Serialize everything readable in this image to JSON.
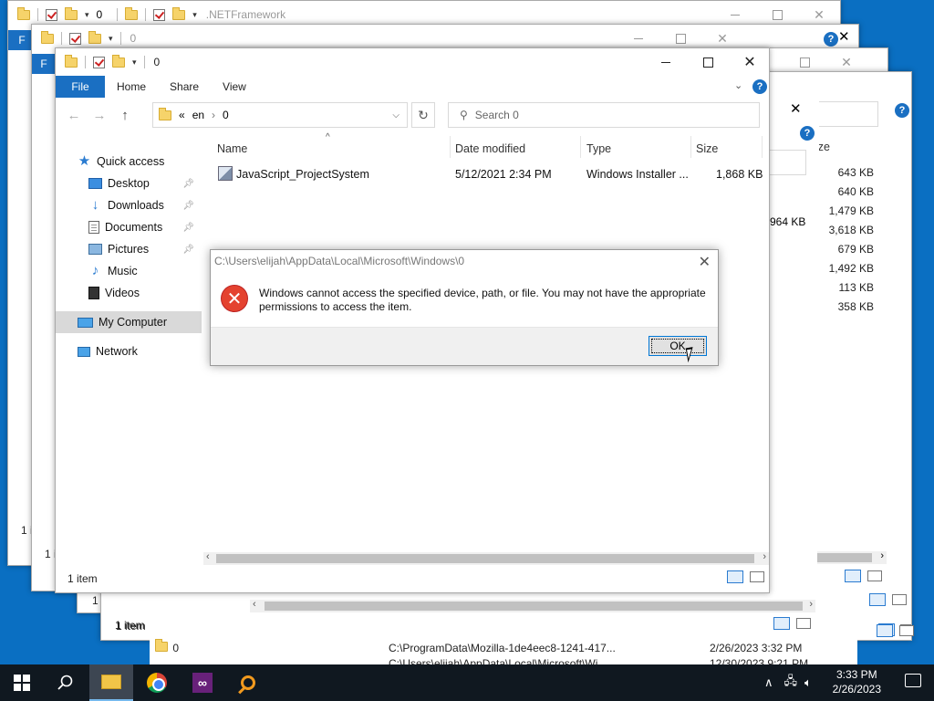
{
  "background_windows": {
    "win1": {
      "title": ".NETFramework",
      "qat_number": "0",
      "first_tab": "F",
      "status": "1 i"
    },
    "win2": {
      "title": "0",
      "qat_number": "",
      "first_tab": "F",
      "status": "1 i"
    },
    "back_right": {
      "sizes": [
        "643 KB",
        "640 KB",
        "1,479 KB",
        "3,618 KB",
        "679 KB",
        "1,492 KB",
        "113 KB",
        "358 KB"
      ],
      "size_header": "ize",
      "mid_size": "964 KB",
      "status_1": "1 item",
      "status_2": "1 i",
      "status_3": "1 item"
    },
    "under_rows": [
      {
        "name": "0",
        "path": "C:\\ProgramData\\Mozilla-1de4eec8-1241-417...",
        "date": "2/26/2023 3:32 PM"
      },
      {
        "name": "0",
        "path": "C:\\Users\\elijah\\AppData\\Local\\Microsoft\\Wi...",
        "date": "12/30/2023 9:21 PM"
      }
    ]
  },
  "window": {
    "qat_number": "0",
    "title": "0",
    "ribbon": {
      "file": "File",
      "home": "Home",
      "share": "Share",
      "view": "View"
    },
    "address": {
      "prefix": "«",
      "crumb1": "en",
      "crumb2": "0"
    },
    "search_placeholder": "Search 0",
    "nav": {
      "quick_access": "Quick access",
      "desktop": "Desktop",
      "downloads": "Downloads",
      "documents": "Documents",
      "pictures": "Pictures",
      "music": "Music",
      "videos": "Videos",
      "my_computer": "My Computer",
      "network": "Network"
    },
    "columns": {
      "name": "Name",
      "date": "Date modified",
      "type": "Type",
      "size": "Size"
    },
    "files": [
      {
        "name": "JavaScript_ProjectSystem",
        "date": "5/12/2021 2:34 PM",
        "type": "Windows Installer ...",
        "size": "1,868 KB",
        "icon": "installer-icon"
      }
    ],
    "status": "1 item"
  },
  "dialog": {
    "title": "C:\\Users\\elijah\\AppData\\Local\\Microsoft\\Windows\\0",
    "message": "Windows cannot access the specified device, path, or file. You may not have the appropriate permissions to access the item.",
    "ok": "OK",
    "icon": "error-icon"
  },
  "taskbar": {
    "time": "3:33 PM",
    "date": "2/26/2023",
    "apps": [
      "start-icon",
      "search-icon",
      "file-explorer-icon",
      "chrome-icon",
      "visual-studio-icon",
      "search-tool-icon"
    ],
    "colors": {
      "bar": "#101820",
      "accent": "#1a6fc2"
    }
  }
}
